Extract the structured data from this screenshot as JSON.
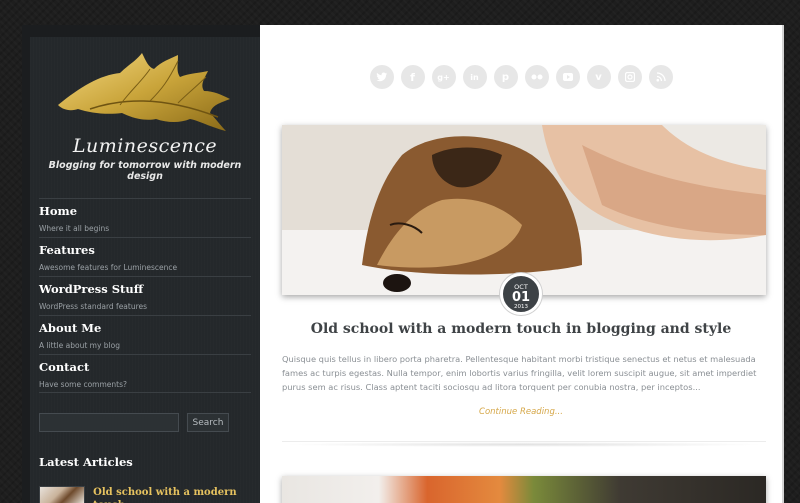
{
  "site": {
    "title": "Luminescence",
    "tagline": "Blogging for tomorrow with modern design"
  },
  "nav": [
    {
      "label": "Home",
      "sub": "Where it all begins"
    },
    {
      "label": "Features",
      "sub": "Awesome features for Luminescence"
    },
    {
      "label": "WordPress Stuff",
      "sub": "WordPress standard features"
    },
    {
      "label": "About Me",
      "sub": "A little about my blog"
    },
    {
      "label": "Contact",
      "sub": "Have some comments?"
    }
  ],
  "search": {
    "placeholder": "",
    "button_label": "Search"
  },
  "latest": {
    "title": "Latest Articles",
    "items": [
      {
        "label": "Old school with a modern touch"
      }
    ]
  },
  "social": [
    "twitter-icon",
    "facebook-icon",
    "googleplus-icon",
    "linkedin-icon",
    "pinterest-icon",
    "flickr-icon",
    "youtube-icon",
    "vimeo-icon",
    "instagram-icon",
    "rss-icon"
  ],
  "post": {
    "date_month": "OCT",
    "date_day": "01",
    "date_year": "2013",
    "title": "Old school with a modern touch in blogging and style",
    "excerpt": "Quisque quis tellus in libero porta pharetra. Pellentesque habitant morbi tristique senectus et netus et malesuada fames ac turpis egestas. Nulla tempor, enim lobortis varius fringilla, velit lorem suscipit augue, sit amet imperdiet purus sem ac risus. Class aptent taciti sociosqu ad litora torquent per conubia nostra, per inceptos...",
    "read_more": "Continue Reading..."
  },
  "colors": {
    "accent": "#d6a84a",
    "sidebar": "#24282b",
    "gold_logo": "#c9a43a"
  }
}
